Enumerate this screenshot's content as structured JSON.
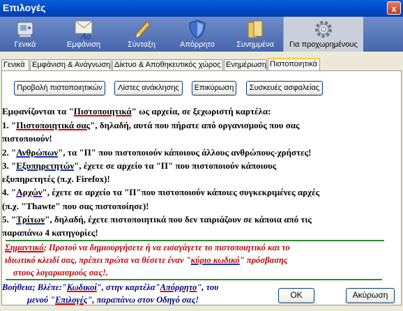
{
  "window": {
    "title": "Επιλογές",
    "close_label": "x"
  },
  "toolbar": {
    "items": [
      {
        "label": "Γενικά",
        "icon": "general-icon"
      },
      {
        "label": "Εμφάνιση",
        "icon": "font-icon"
      },
      {
        "label": "Σύνταξη",
        "icon": "pen-icon"
      },
      {
        "label": "Απόρρητο",
        "icon": "shield-icon"
      },
      {
        "label": "Συνημμένα",
        "icon": "folder-icon"
      },
      {
        "label": "Για προχωρημένους",
        "icon": "gear-icon"
      }
    ]
  },
  "tabs": [
    "Γενικά",
    "Εμφάνιση & Ανάγνωση",
    "Δίκτυο & Αποθηκευτικός χώρος",
    "Ενημέρωση",
    "Πιστοποιητικά"
  ],
  "buttons": {
    "view_certs": "Προβολή πιστοποιητικών",
    "revocation_lists": "Λίστες ανάκλησης",
    "validation": "Επικύρωση",
    "security_devices": "Συσκευές ασφαλείας"
  },
  "text": {
    "intro_a": "Εμφανίζονται τα \"",
    "intro_b": "Πιστοποιητικά",
    "intro_c": "\" ως αρχεία, σε ξεχωριστή καρτέλα:",
    "l1_a": "1. \"",
    "l1_b": "Πιστοποιητικά σας",
    "l1_c": "\", δηλαδή, αυτά που πήρατε από οργανισμούς που σας",
    "l1_d": "πιστοποιούν!",
    "l2_a": "2. \"",
    "l2_b": "Ανθρώπων",
    "l2_c": "\", τα \"Π\" που πιστοποιούν κάποιους άλλους ανθρώπους-χρήστες!",
    "l3_a": "3. \"",
    "l3_b": "Εξυπηρετητών",
    "l3_c": "\", έχετε σε αρχείο τα \"Π\" που πιστοποιούν κάποιους",
    "l3_d": "εξυπηρετητές (π.χ. Firefox)!",
    "l4_a": "4. \"",
    "l4_b": "Αρχών",
    "l4_c": "\", έχετε σε αρχείο τα \"Π\"που πιστοποιούν κάποιες συγκεκριμένες αρχές",
    "l4_d": "(π.χ. \"Thawte\" που σας πιστοποίησε)!",
    "l5_a": "5. \"",
    "l5_b": "Τρίτων",
    "l5_c": "\", δηλαδή, έχετε πιστοποιητικά που δεν ταιριάζουν σε κάποια από τις",
    "l5_d": "παραπάνω 4 κατηγορίες!"
  },
  "note": {
    "a": "Σημαντικό",
    "b": "; Προτού να δημιουργήσετε ή να εισαγάγετε το πιστοποιητικό και το",
    "c": "ιδιωτικό κλειδί σας, πρέπει πρώτα να θέσετε έναν \"",
    "d": "κύριο κωδικό",
    "e": "\" πρόσβασης",
    "f": "στους λογαριασμούς σας!."
  },
  "help": {
    "a": "Βοήθεια; Βλέπε:\"",
    "b": "Κωδικοί",
    "c": "\", στην καρτέλα\"",
    "d": "Απόρρητο",
    "e": "\", του",
    "f": "μενού \"",
    "g": "Επιλογές",
    "h": "\", παραπάνω στον Οδηγό σας!"
  },
  "dialog_buttons": {
    "ok": "OK",
    "cancel": "Ακύρωση"
  },
  "colors": {
    "note_red": "#C00000",
    "help_blue": "#000080",
    "divider_green": "#2E8B2E",
    "title_blue": "#0A5FD8"
  }
}
